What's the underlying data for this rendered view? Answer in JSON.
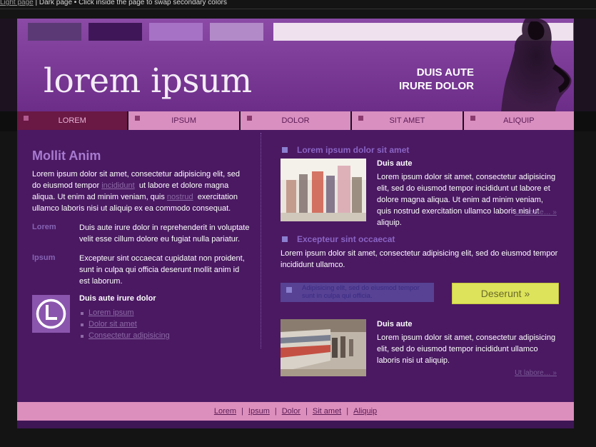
{
  "topbar": {
    "light_link": "Light page",
    "rest": " | Dark page • Click inside the page to swap secondary colors"
  },
  "header": {
    "logo": "lorem ipsum",
    "tagline_line1": "DUIS AUTE",
    "tagline_line2": "IRURE DOLOR"
  },
  "nav": {
    "items": [
      "LOREM",
      "IPSUM",
      "DOLOR",
      "SIT AMET",
      "ALIQUIP"
    ],
    "active": "LOREM"
  },
  "left": {
    "title": "Mollit Anim",
    "intro_p1": "Lorem ipsum dolor sit amet, consectetur adipisicing elit, sed do eiusmod tempor",
    "intro_link1": "incididunt",
    "intro_p2": "ut labore et dolore magna aliqua. Ut enim ad minim veniam, quis",
    "intro_link2": "nostrud",
    "intro_p3": "exercitation ullamco laboris nisi ut aliquip ex ea commodo consequat.",
    "defs": [
      {
        "term": "Lorem",
        "text": "Duis aute irure dolor in reprehenderit in voluptate velit esse cillum dolore eu fugiat nulla pariatur."
      },
      {
        "term": "Ipsum",
        "text": "Excepteur sint occaecat cupidatat non proident, sunt in culpa qui officia deserunt mollit anim id est laborum."
      }
    ],
    "clock_title": "Duis aute irure dolor",
    "clock_links": [
      "Lorem ipsum",
      "Dolor sit amet",
      "Consectetur adipisicing"
    ]
  },
  "right": {
    "sec1_title": "Lorem ipsum dolor sit amet",
    "item1_title": "Duis aute",
    "item1_body": "Lorem ipsum dolor sit amet, consectetur adipisicing elit, sed do eiusmod tempor incididunt ut labore et dolore magna aliqua. Ut enim ad minim veniam, quis nostrud exercitation ullamco laboris nisi ut aliquip.",
    "item1_more": "Ut labore… »",
    "sec2_title": "Excepteur sint occaecat",
    "sec2_body": "Lorem ipsum dolor sit amet, consectetur adipisicing elit, sed do eiusmod tempor incididunt ullamco.",
    "callout": "Adipisicing elit, sed do eiusmod tempor sunt in culpa qui officia.",
    "cta": "Deserunt »",
    "item2_title": "Duis aute",
    "item2_body": "Lorem ipsum dolor sit amet, consectetur adipisicing elit, sed do eiusmod tempor incididunt ullamco laboris nisi ut aliquip.",
    "item2_more": "Ut labore… »"
  },
  "footer": {
    "links": [
      "Lorem",
      "Ipsum",
      "Dolor",
      "Sit amet",
      "Aliquip"
    ]
  },
  "colors": {
    "page_bg": "#4a1962",
    "header": "#7c3c98",
    "nav": "#d98fc0",
    "nav_active": "#6a1844",
    "cta": "#dde35a",
    "footer": "#dc8fbd"
  },
  "icons": {
    "clock": "clock-icon",
    "woman": "woman-silhouette-icon"
  }
}
